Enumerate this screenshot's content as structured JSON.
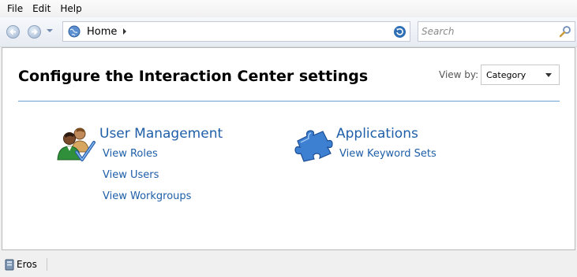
{
  "menu": {
    "items": [
      {
        "label": "File"
      },
      {
        "label": "Edit"
      },
      {
        "label": "Help"
      }
    ]
  },
  "nav": {
    "address": "Home",
    "search_placeholder": "Search"
  },
  "page": {
    "title": "Configure the Interaction Center settings",
    "view_by_label": "View by:",
    "view_by_value": "Category"
  },
  "categories": [
    {
      "title": "User Management",
      "icon": "users-icon",
      "links": [
        "View Roles",
        "View Users",
        "View Workgroups"
      ]
    },
    {
      "title": "Applications",
      "icon": "puzzle-icon",
      "links": [
        "View Keyword Sets"
      ]
    }
  ],
  "status": {
    "server": "Eros"
  },
  "colors": {
    "link": "#1e5ea8",
    "divider": "#6aa0cf"
  }
}
